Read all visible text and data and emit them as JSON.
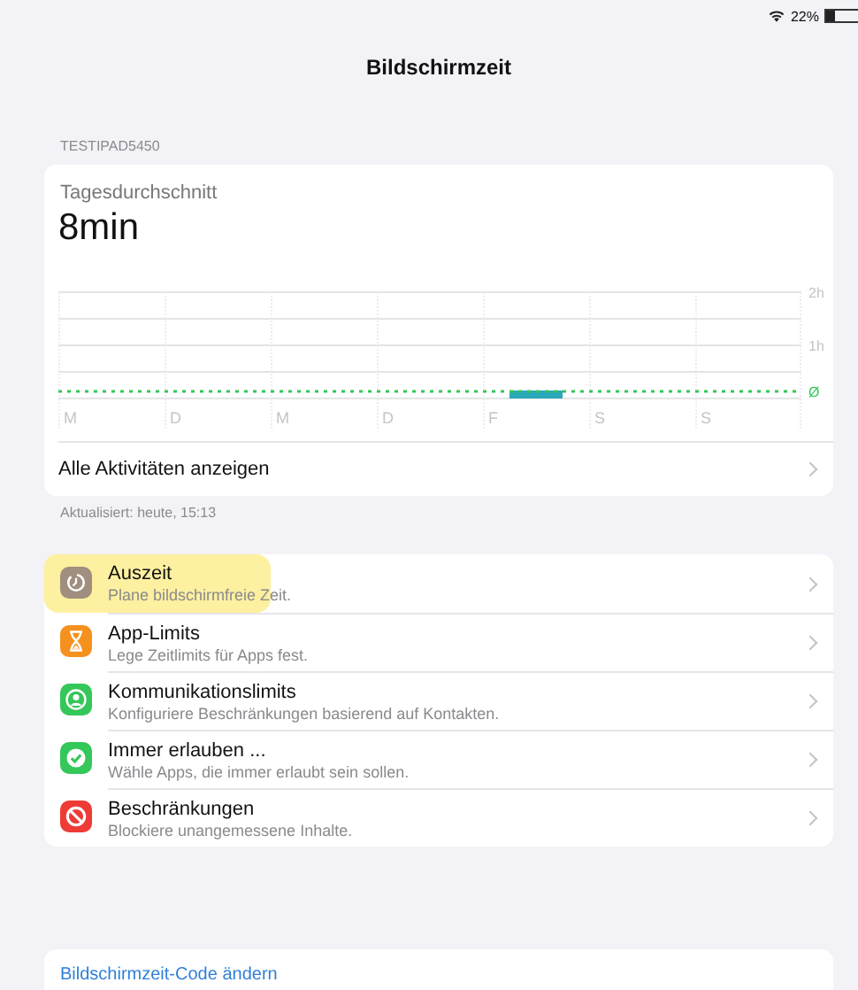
{
  "status_bar": {
    "battery_text": "22%"
  },
  "title": "Bildschirmzeit",
  "device": "TESTIPAD5450",
  "summary": {
    "label": "Tagesdurchschnitt",
    "value": "8min",
    "chart_data": {
      "type": "bar",
      "categories": [
        "M",
        "D",
        "M",
        "D",
        "F",
        "S",
        "S"
      ],
      "values": [
        0,
        0,
        0,
        0,
        0.15,
        0,
        0
      ],
      "ylim": [
        0,
        2
      ],
      "yticks": [
        {
          "value": 1,
          "label": "1h"
        },
        {
          "value": 2,
          "label": "2h"
        }
      ]
    },
    "average_marker": "Ø",
    "link": "Alle Aktivitäten anzeigen"
  },
  "updated": "Aktualisiert: heute, 15:13",
  "items": [
    {
      "kind": "downtime",
      "title": "Auszeit",
      "subtitle": "Plane bildschirmfreie Zeit.",
      "color": "#a08e7e",
      "highlighted": true
    },
    {
      "kind": "limits",
      "title": "App-Limits",
      "subtitle": "Lege Zeitlimits für Apps fest.",
      "color": "#f5921e",
      "highlighted": false
    },
    {
      "kind": "communication",
      "title": "Kommunikationslimits",
      "subtitle": "Konfiguriere Beschränkungen basierend auf Kontakten.",
      "color": "#34c759",
      "highlighted": false
    },
    {
      "kind": "always",
      "title": "Immer erlauben ...",
      "subtitle": "Wähle Apps, die immer erlaubt sein sollen.",
      "color": "#34c759",
      "highlighted": false
    },
    {
      "kind": "restrictions",
      "title": "Beschränkungen",
      "subtitle": "Blockiere unangemessene Inhalte.",
      "color": "#ee3b35",
      "highlighted": false
    }
  ],
  "code_link": "Bildschirmzeit-Code ändern"
}
